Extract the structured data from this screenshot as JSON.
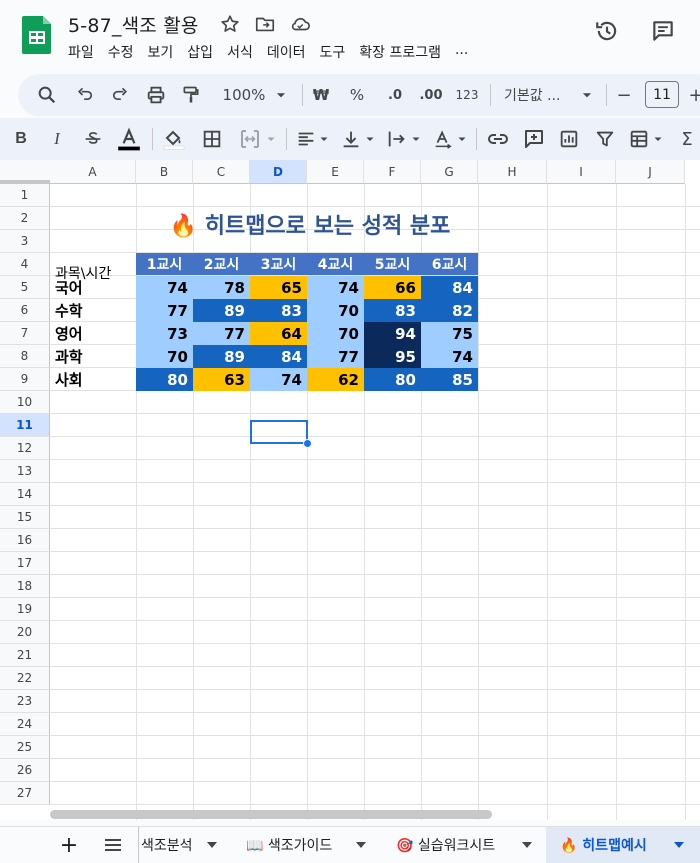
{
  "app": {
    "doc_title": "5-87_색조 활용",
    "menu": [
      "파일",
      "수정",
      "보기",
      "삽입",
      "서식",
      "데이터",
      "도구",
      "확장 프로그램",
      "..."
    ]
  },
  "toolbar": {
    "zoom": "100%",
    "currency": "₩",
    "percent": "%",
    "dec_decrease": ".0",
    "dec_increase": ".00",
    "number_format": "123",
    "font_name": "기본값 ...",
    "font_size": "11",
    "minus": "−",
    "plus": "+"
  },
  "columns": [
    "A",
    "B",
    "C",
    "D",
    "E",
    "F",
    "G",
    "H",
    "I",
    "J"
  ],
  "rows": [
    "1",
    "2",
    "3",
    "4",
    "5",
    "6",
    "7",
    "8",
    "9",
    "10",
    "11",
    "12",
    "13",
    "14",
    "15",
    "16",
    "17",
    "18",
    "19",
    "20",
    "21",
    "22",
    "23",
    "24",
    "25",
    "26",
    "27"
  ],
  "selected_cell": "D11",
  "sheet": {
    "title": "🔥 히트맵으로 보는 성적 분포",
    "corner_label": "과목\\시간",
    "periods": [
      "1교시",
      "2교시",
      "3교시",
      "4교시",
      "5교시",
      "6교시"
    ],
    "subjects": [
      {
        "name": "국어",
        "scores": [
          "74",
          "78",
          "65",
          "74",
          "66",
          "84"
        ]
      },
      {
        "name": "수학",
        "scores": [
          "77",
          "89",
          "83",
          "70",
          "83",
          "82"
        ]
      },
      {
        "name": "영어",
        "scores": [
          "73",
          "77",
          "64",
          "70",
          "94",
          "75"
        ]
      },
      {
        "name": "과학",
        "scores": [
          "70",
          "89",
          "84",
          "77",
          "95",
          "74"
        ]
      },
      {
        "name": "사회",
        "scores": [
          "80",
          "63",
          "74",
          "62",
          "80",
          "85"
        ]
      }
    ]
  },
  "colors": {
    "header_fill": "#4472c4",
    "title_color": "#2f5496",
    "light_blue": "#9fcdff",
    "mid_blue": "#1565c0",
    "dark_navy": "#0b2a5b",
    "gold": "#ffc000",
    "selection": "#1a73e8"
  },
  "tabs": [
    {
      "label": "색조분석"
    },
    {
      "label": "📖 색조가이드"
    },
    {
      "label": "🎯 실습워크시트"
    },
    {
      "label": "🔥 히트맵예시",
      "active": true
    }
  ],
  "icons": {
    "star": "star-icon",
    "move": "move-folder-icon",
    "cloud": "cloud-status-icon",
    "history": "history-icon",
    "comments": "comment-icon"
  }
}
